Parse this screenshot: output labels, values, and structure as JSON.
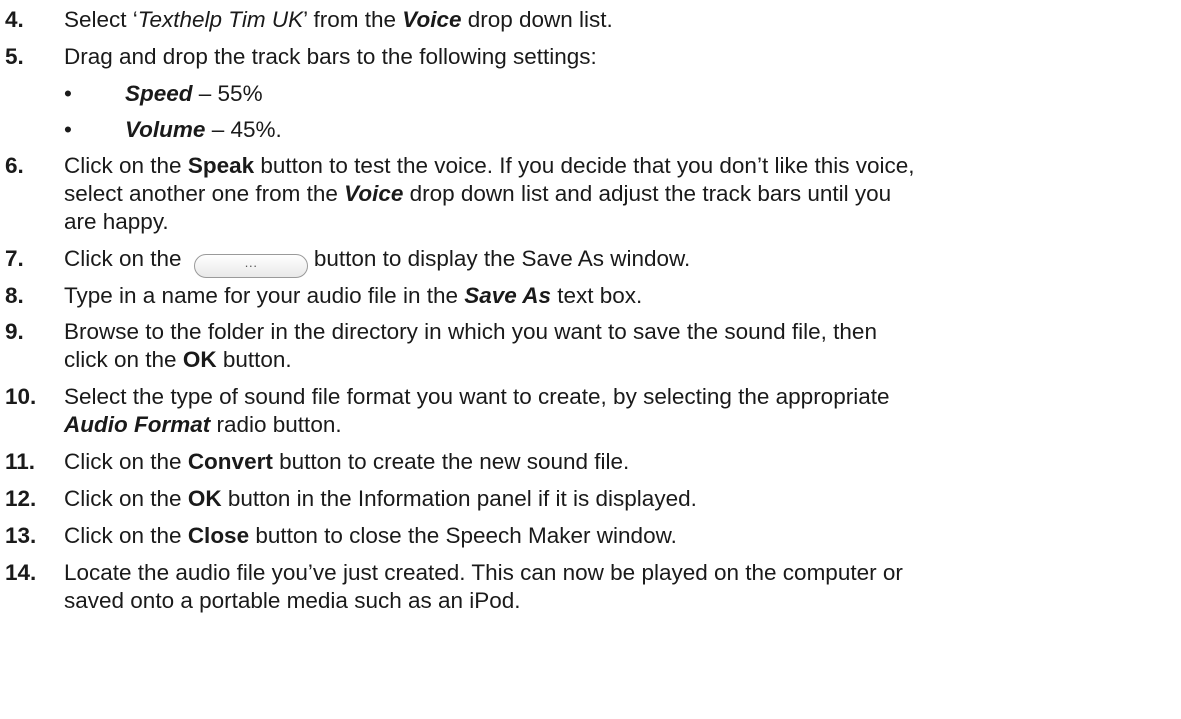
{
  "steps": [
    {
      "num": "4.",
      "parts": [
        "Select ‘",
        "Texthelp Tim UK",
        "’ from the ",
        "Voice",
        " drop down list."
      ]
    },
    {
      "num": "5.",
      "text": "Drag and drop the track bars to the following settings:"
    },
    {
      "num": "6.",
      "parts": [
        "Click on the ",
        "Speak",
        " button to test the voice. If you decide that you don’t like this voice,",
        "select another one from the ",
        "Voice",
        " drop down list and adjust the track bars until you",
        "are happy."
      ]
    },
    {
      "num": "7.",
      "parts": [
        "Click on the ",
        "button to display the Save As window."
      ]
    },
    {
      "num": "8.",
      "parts": [
        "Type in a name for your audio file in the ",
        "Save As",
        " text box."
      ]
    },
    {
      "num": "9.",
      "parts": [
        "Browse to the folder in the directory in which you want to save the sound file, then",
        "click on the ",
        "OK",
        " button."
      ]
    },
    {
      "num": "10.",
      "parts": [
        "Select the type of sound file format you want to create, by selecting the appropriate",
        "Audio Format",
        " radio button."
      ]
    },
    {
      "num": "11.",
      "parts": [
        "Click on the ",
        "Convert",
        " button to create the new sound file."
      ]
    },
    {
      "num": "12.",
      "parts": [
        "Click on the ",
        "OK",
        " button in the Information panel if it is displayed."
      ]
    },
    {
      "num": "13.",
      "parts": [
        "Click on the ",
        "Close",
        " button to close the Speech Maker window."
      ]
    },
    {
      "num": "14.",
      "parts": [
        "Locate the audio file you’ve just created. This can now be played on the computer or",
        "saved onto a portable media such as an iPod."
      ]
    }
  ],
  "bullets": [
    {
      "symbol": "•",
      "label": "Speed",
      "value": " – 55%"
    },
    {
      "symbol": "•",
      "label": "Volume",
      "value": " – 45%."
    }
  ],
  "ellipsis_button": {
    "label": "···"
  }
}
